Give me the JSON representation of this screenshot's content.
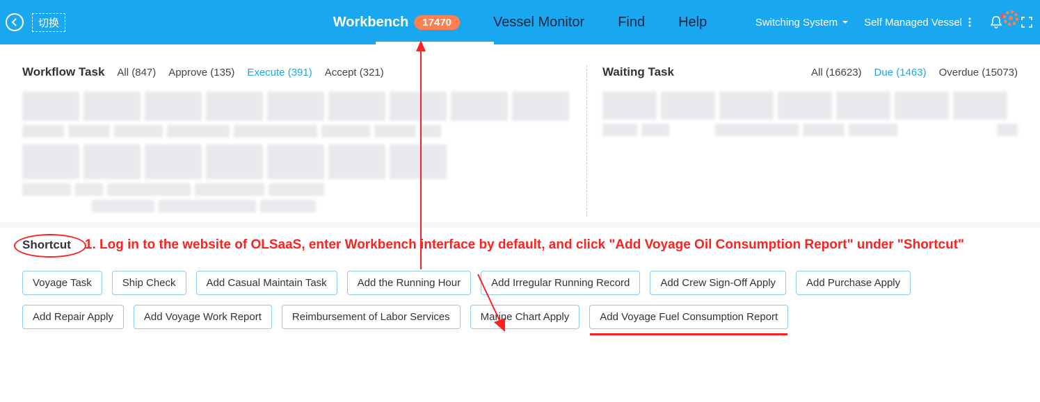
{
  "topbar": {
    "switch_label": "切换",
    "nav": {
      "workbench": "Workbench",
      "workbench_badge": "17470",
      "vessel_monitor": "Vessel Monitor",
      "find": "Find",
      "help": "Help"
    },
    "right": {
      "switching_system": "Switching System",
      "self_managed": "Self Managed Vessel"
    }
  },
  "workflow": {
    "title": "Workflow Task",
    "filters": {
      "all": "All (847)",
      "approve": "Approve (135)",
      "execute": "Execute (391)",
      "accept": "Accept (321)"
    }
  },
  "waiting": {
    "title": "Waiting Task",
    "filters": {
      "all": "All (16623)",
      "due": "Due (1463)",
      "overdue": "Overdue (15073)"
    }
  },
  "shortcut": {
    "title": "Shortcut",
    "instruction": "1. Log in to the website of OLSaaS, enter Workbench interface by default, and click \"Add Voyage Oil Consumption Report\" under \"Shortcut\"",
    "buttons": {
      "voyage_task": "Voyage Task",
      "ship_check": "Ship Check",
      "add_casual_maintain": "Add Casual Maintain Task",
      "add_running_hour": "Add the Running Hour",
      "add_irregular_running": "Add Irregular Running Record",
      "add_crew_signoff": "Add Crew Sign-Off Apply",
      "add_purchase": "Add Purchase Apply",
      "add_repair": "Add Repair Apply",
      "add_voyage_work": "Add Voyage Work Report",
      "reimbursement_labor": "Reimbursement of Labor Services",
      "marine_chart": "Marine Chart Apply",
      "add_voyage_fuel": "Add Voyage Fuel Consumption Report"
    }
  }
}
